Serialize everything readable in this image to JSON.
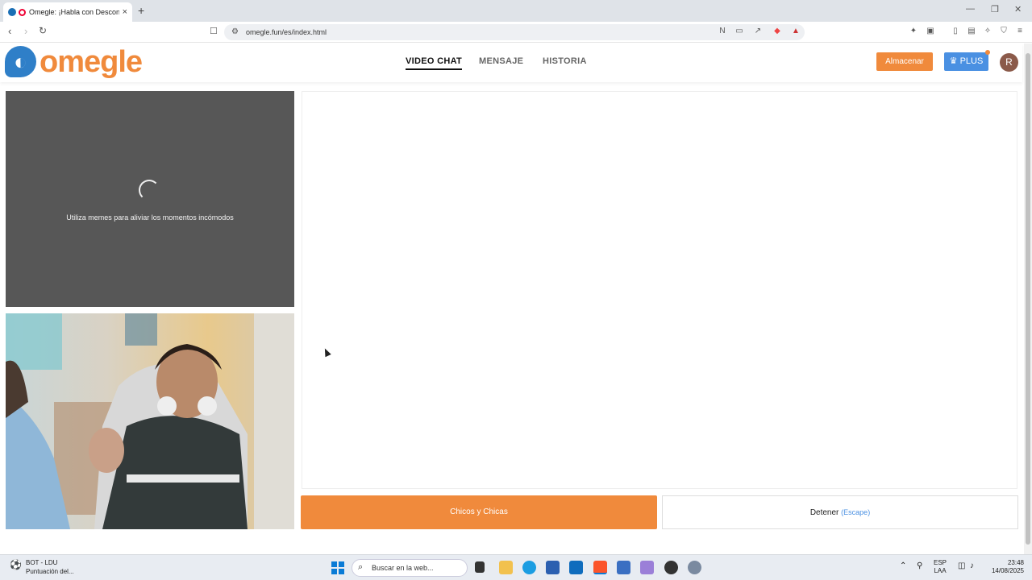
{
  "browser": {
    "tab_title": "Omegle: ¡Habla con Desconocidos!",
    "tab_close": "×",
    "new_tab": "+",
    "url": "omegle.fun/es/index.html",
    "win_minimize": "—",
    "win_restore": "❐",
    "win_close": "✕"
  },
  "site": {
    "logo_text": "omegle",
    "nav": [
      {
        "label": "VIDEO CHAT",
        "active": true
      },
      {
        "label": "MENSAJE",
        "active": false
      },
      {
        "label": "HISTORIA",
        "active": false
      }
    ],
    "store_button": "Almacenar",
    "plus_button": "♛ PLUS",
    "avatar_initial": "R"
  },
  "main": {
    "stranger_tip": "Utiliza memes para aliviar los momentos incómodos",
    "gender_button": "Chicos y Chicas",
    "stop_button": "Detener",
    "stop_hint": "(Escape)"
  },
  "taskbar": {
    "weather_line1": "BOT - LDU",
    "weather_line2": "Puntuación del...",
    "search_placeholder": "Buscar en la web...",
    "lang_line1": "ESP",
    "lang_line2": "LAA",
    "time": "23:48",
    "date": "14/08/2025"
  },
  "colors": {
    "brand_orange": "#f08a3c",
    "brand_blue": "#4a90e2"
  }
}
